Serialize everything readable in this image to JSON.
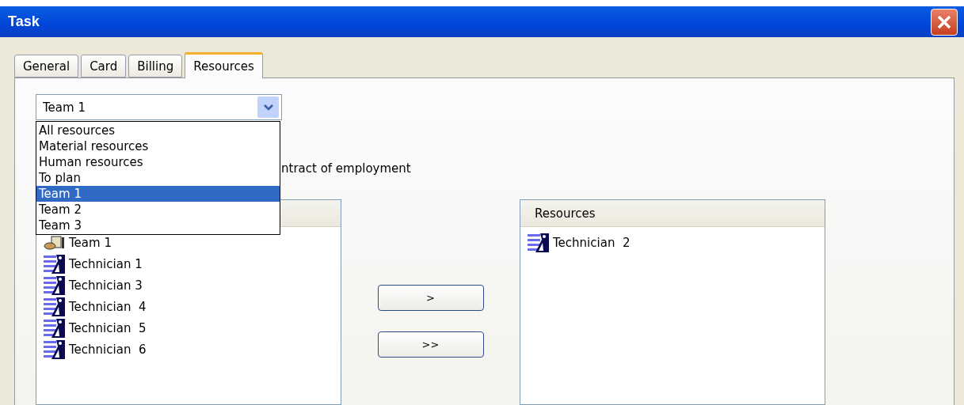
{
  "window": {
    "title": "Task"
  },
  "tabs": [
    {
      "label": "General",
      "selected": false
    },
    {
      "label": "Card",
      "selected": false
    },
    {
      "label": "Billing",
      "selected": false
    },
    {
      "label": "Resources",
      "selected": true
    }
  ],
  "filter": {
    "value": "Team 1",
    "expanded": true,
    "options": [
      {
        "label": "All resources",
        "selected": false
      },
      {
        "label": "Material resources",
        "selected": false
      },
      {
        "label": "Human resources",
        "selected": false
      },
      {
        "label": "To plan",
        "selected": false
      },
      {
        "label": "Team 1",
        "selected": true
      },
      {
        "label": "Team 2",
        "selected": false
      },
      {
        "label": "Team 3",
        "selected": false
      }
    ]
  },
  "partial_label": "ntract of employment",
  "available_list": {
    "items": [
      {
        "kind": "team",
        "label": "Team 1"
      },
      {
        "kind": "person",
        "label": "Technician 1"
      },
      {
        "kind": "person",
        "label": "Technician 3"
      },
      {
        "kind": "person",
        "label": "Technician  4"
      },
      {
        "kind": "person",
        "label": "Technician  5"
      },
      {
        "kind": "person",
        "label": "Technician  6"
      }
    ]
  },
  "buttons": [
    ">",
    ">>"
  ],
  "assigned_list": {
    "header": "Resources",
    "items": [
      {
        "kind": "person",
        "label": "Technician  2"
      }
    ]
  }
}
